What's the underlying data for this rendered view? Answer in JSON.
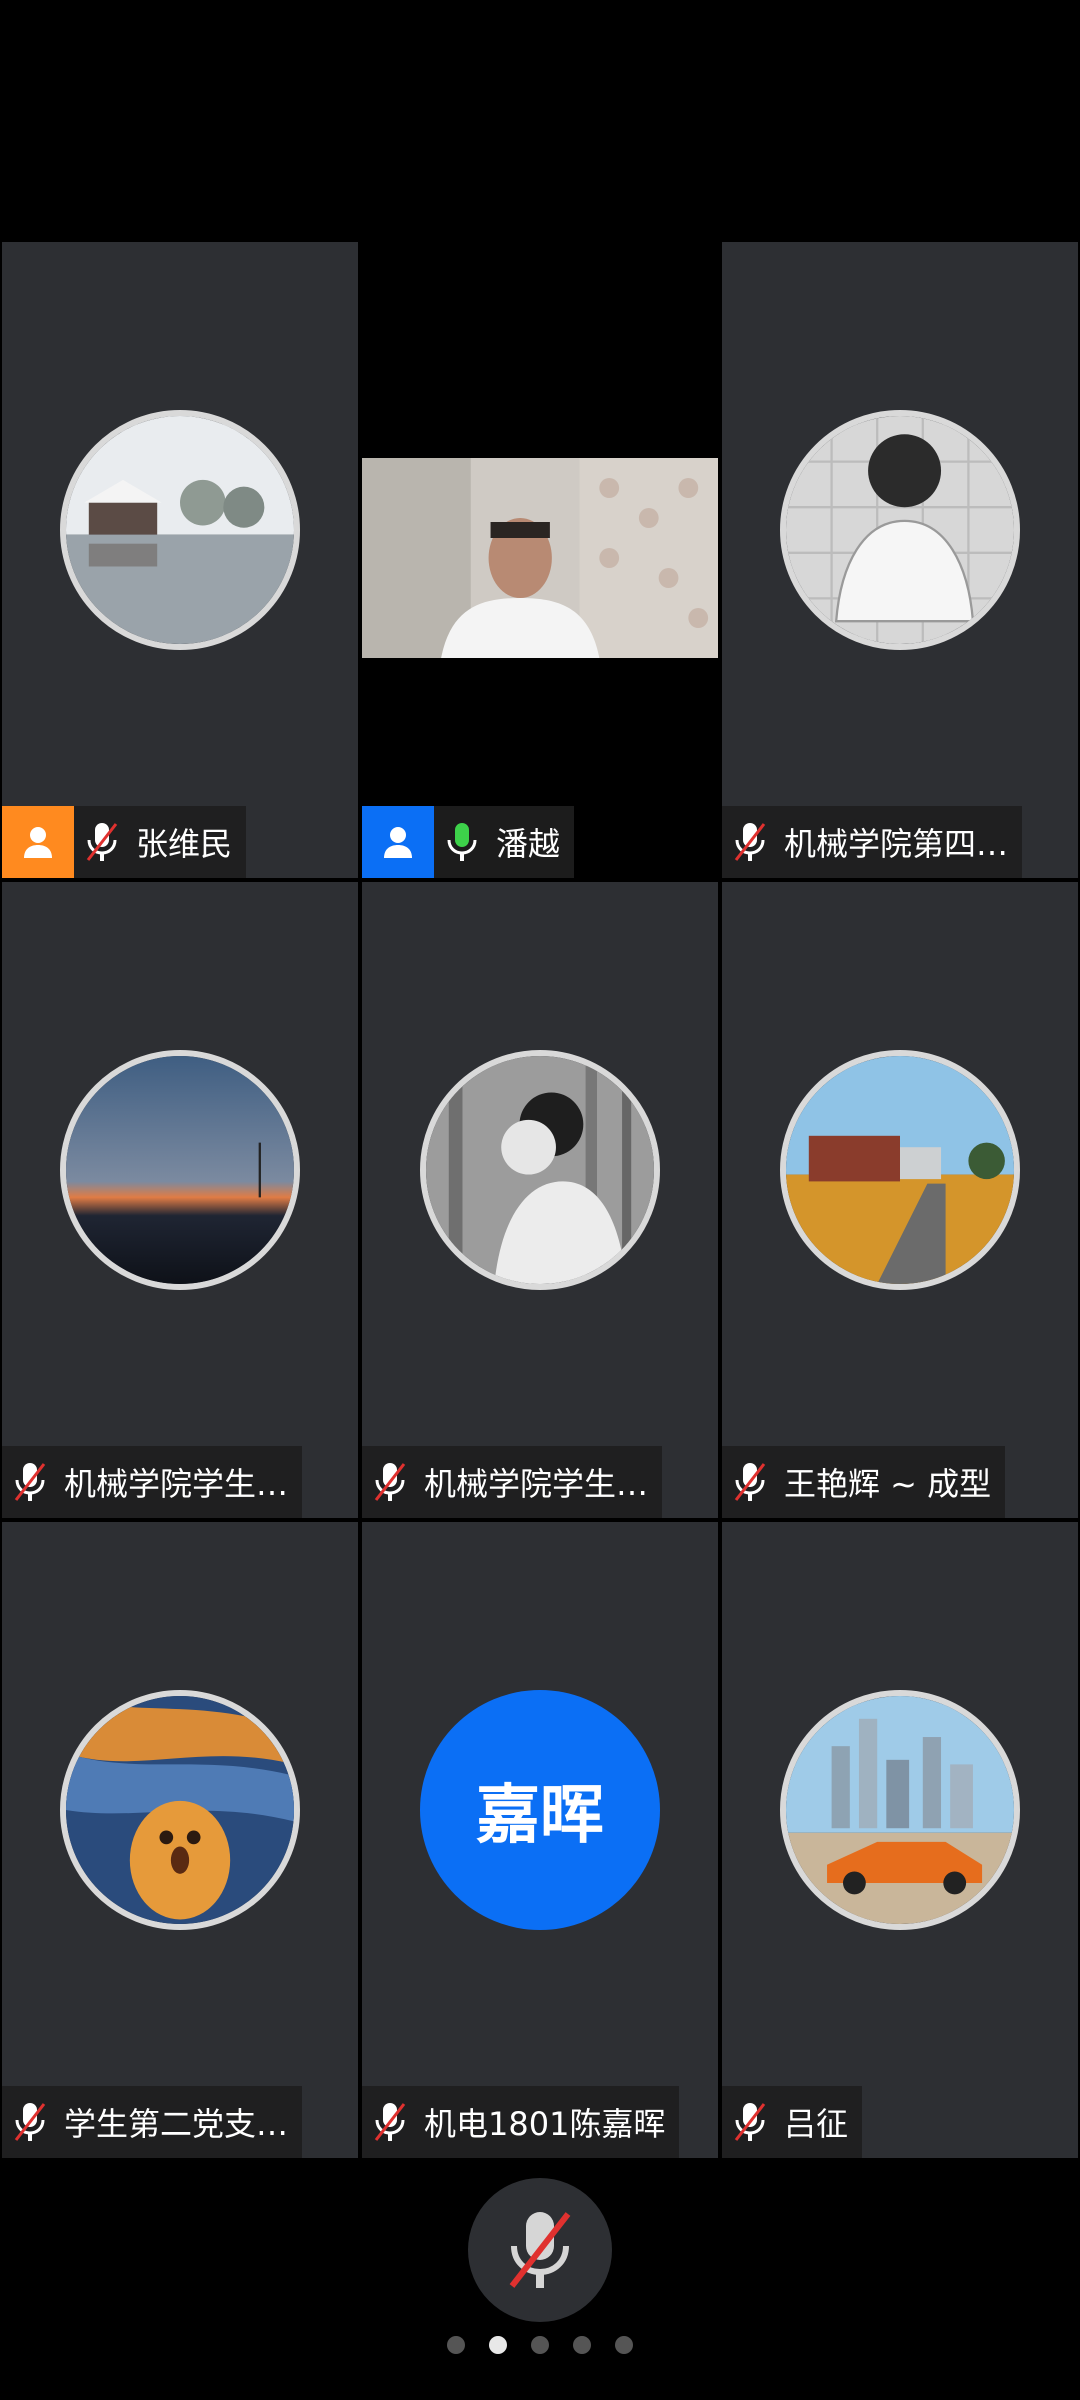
{
  "participants": [
    {
      "name": "张维民",
      "role": "host",
      "host_color": "#ff8a1f",
      "mic": "muted",
      "avatar": "winter-lake-photo"
    },
    {
      "name": "潘越",
      "role": "cohost",
      "host_color": "#0b6ff5",
      "mic": "active",
      "avatar": "video-feed"
    },
    {
      "name": "机械学院第四…",
      "mic": "muted",
      "avatar": "astronaut-photo"
    },
    {
      "name": "机械学院学生…",
      "mic": "muted",
      "avatar": "sunset-landscape-photo"
    },
    {
      "name": "机械学院学生…",
      "mic": "muted",
      "avatar": "person-with-flowers-photo"
    },
    {
      "name": "王艳辉 ~ 成型",
      "mic": "muted",
      "avatar": "campus-building-photo"
    },
    {
      "name": "学生第二党支…",
      "mic": "muted",
      "avatar": "cat-scream-painting"
    },
    {
      "name": "机电1801陈嘉晖",
      "mic": "muted",
      "avatar": "initials",
      "initials": "嘉晖",
      "initials_color": "#0b6ff5"
    },
    {
      "name": "吕征",
      "mic": "muted",
      "avatar": "sports-car-city-photo"
    }
  ],
  "controls": {
    "mic_button": "mic-muted-icon"
  },
  "pagination": {
    "pages": 5,
    "current": 2
  }
}
